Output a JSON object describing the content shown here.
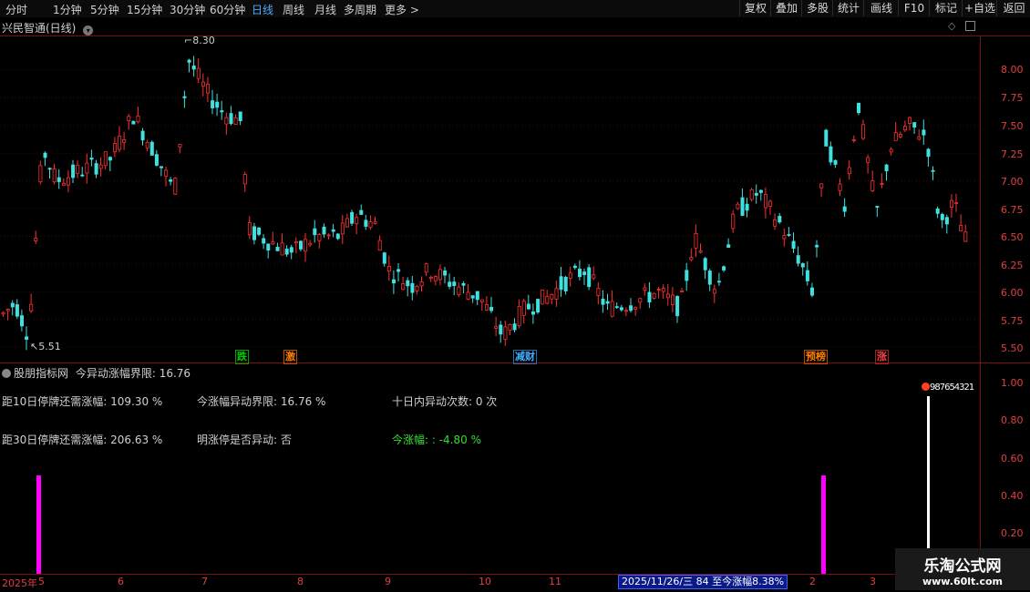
{
  "toolbar": {
    "periods": [
      "分时",
      "1分钟",
      "5分钟",
      "15分钟",
      "30分钟",
      "60分钟",
      "日线",
      "周线",
      "月线",
      "多周期",
      "更多 >"
    ],
    "active_period": "日线",
    "buttons": [
      "复权",
      "叠加",
      "多股",
      "统计",
      "画线",
      "F10",
      "标记",
      "+自选",
      "返回"
    ]
  },
  "main_chart": {
    "stock_title": "兴民智通(日线)",
    "y_axis_labels": [
      "8.00",
      "7.75",
      "7.50",
      "7.25",
      "7.00",
      "6.75",
      "6.50",
      "6.25",
      "6.00",
      "5.75",
      "5.50"
    ],
    "high_marker": "8.30",
    "low_marker": "5.51",
    "signals": [
      {
        "text": "跌",
        "color": "#00d000"
      },
      {
        "text": "激",
        "color": "#ff8000"
      },
      {
        "text": "减财",
        "color": "#40b0ff"
      },
      {
        "text": "预榜",
        "color": "#ff8000"
      },
      {
        "text": "涨",
        "color": "#ff4040"
      }
    ]
  },
  "indicator": {
    "header_name": "股朋指标网",
    "header_param": "今异动涨幅界限: 16.76",
    "rows": [
      {
        "label": "距10日停牌还需涨幅: 109.30 %"
      },
      {
        "label": "今涨幅异动界限: 16.76 %"
      },
      {
        "label": "十日内异动次数: 0 次"
      },
      {
        "label": "距30日停牌还需涨幅: 206.63 %"
      },
      {
        "label": "明涨停是否异动: 否"
      },
      {
        "label": "今涨幅: : -4.80 %"
      }
    ],
    "y_axis_labels": [
      "1.00",
      "0.80",
      "0.60",
      "0.40",
      "0.20"
    ],
    "tag_value": "987654321"
  },
  "x_axis": {
    "labels": [
      "2025年",
      "5",
      "6",
      "7",
      "8",
      "9",
      "10",
      "11",
      "2",
      "3"
    ],
    "status": "2025/11/26/三 84 至今涨幅8.38%"
  },
  "watermark": {
    "title": "乐淘公式网",
    "url": "www.60lt.com"
  },
  "colors": {
    "up": "#ff3030",
    "down": "#40e0e0",
    "magenta": "#ff00ff",
    "axis": "#7a1010"
  }
}
